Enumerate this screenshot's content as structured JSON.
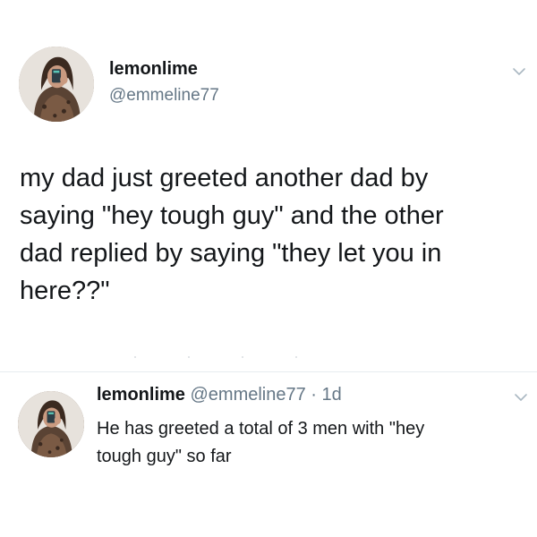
{
  "tweet": {
    "display_name": "lemonlime",
    "handle": "@emmeline77",
    "avatar_icon": "profile-photo-avatar",
    "menu_icon": "chevron-down-icon",
    "text": "my dad just greeted another dad by\nsaying \"hey tough guy\" and the other\ndad replied by saying \"they let you in\nhere??\""
  },
  "reply": {
    "display_name": "lemonlime",
    "handle": "@emmeline77",
    "separator": "·",
    "time": "1d",
    "avatar_icon": "profile-photo-avatar",
    "menu_icon": "chevron-down-icon",
    "text": "He has greeted a total of 3 men with \"hey\ntough guy\" so far"
  },
  "colors": {
    "text_primary": "#14171a",
    "text_secondary": "#657786",
    "divider": "#e6ecf0",
    "background": "#ffffff"
  }
}
